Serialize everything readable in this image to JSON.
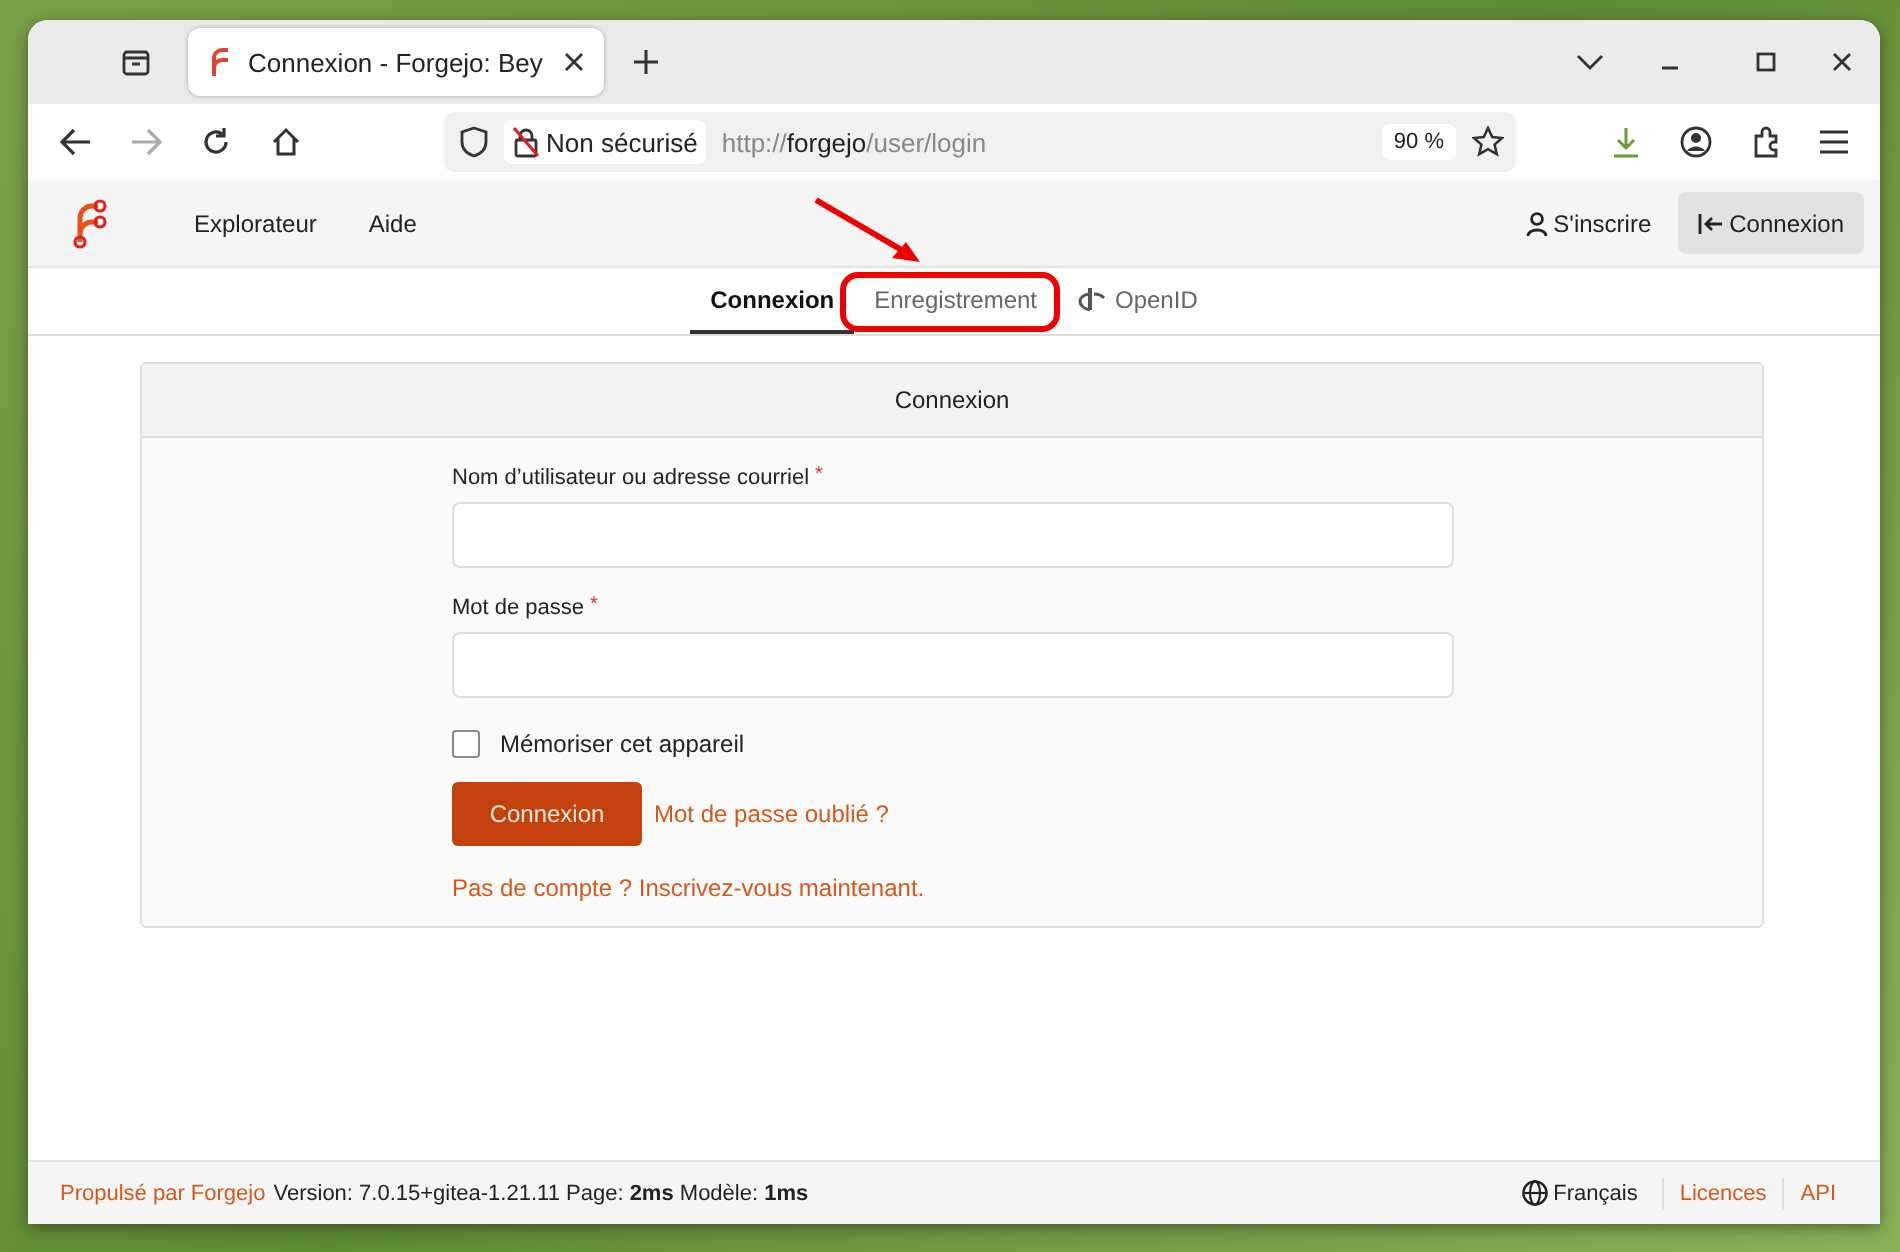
{
  "browser": {
    "tab_title": "Connexion - Forgejo: Bey",
    "security": "Non sécurisé",
    "url_prefix": "http://",
    "url_host": "forgejo",
    "url_path": "/user/login",
    "zoom": "90 %"
  },
  "nav": {
    "items": [
      "Explorateur",
      "Aide"
    ],
    "register": "S'inscrire",
    "login": "Connexion"
  },
  "tabs": [
    {
      "label": "Connexion",
      "selected": true,
      "kind": "plain"
    },
    {
      "label": "Enregistrement",
      "selected": false,
      "kind": "plain"
    },
    {
      "label": "OpenID",
      "selected": false,
      "kind": "openid"
    }
  ],
  "card": {
    "title": "Connexion",
    "fields": [
      {
        "label": "Nom d’utilisateur ou adresse courriel",
        "required_mark": "*"
      },
      {
        "label": "Mot de passe",
        "required_mark": "*"
      }
    ],
    "remember": {
      "label": "Mémoriser cet appareil",
      "checked": false
    },
    "submit": "Connexion",
    "forgot": "Mot de passe oublié ?",
    "signup": "Pas de compte ? Inscrivez-vous maintenant."
  },
  "footer": {
    "powered": "Propulsé par Forgejo",
    "info": "Version: 7.0.15+gitea-1.21.11 Page: **2ms** Modèle: **1ms**",
    "language": "Français",
    "links": [
      "Licences",
      "API"
    ]
  }
}
